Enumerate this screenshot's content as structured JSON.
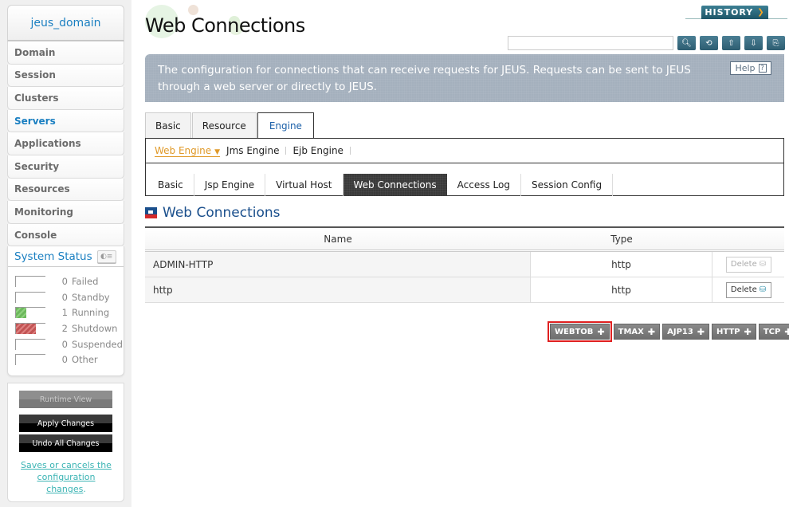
{
  "sidebar": {
    "domain": "jeus_domain",
    "items": [
      {
        "label": "Domain",
        "active": false
      },
      {
        "label": "Session",
        "active": false
      },
      {
        "label": "Clusters",
        "active": false
      },
      {
        "label": "Servers",
        "active": true
      },
      {
        "label": "Applications",
        "active": false
      },
      {
        "label": "Security",
        "active": false
      },
      {
        "label": "Resources",
        "active": false
      },
      {
        "label": "Monitoring",
        "active": false
      },
      {
        "label": "Console",
        "active": false
      }
    ],
    "system_status": {
      "title": "System Status",
      "rows": [
        {
          "count": "0",
          "label": "Failed",
          "fraction": 0
        },
        {
          "count": "0",
          "label": "Standby",
          "fraction": 0
        },
        {
          "count": "1",
          "label": "Running",
          "fraction": 0.33,
          "color": "#6cb85c"
        },
        {
          "count": "2",
          "label": "Shutdown",
          "fraction": 0.67,
          "color": "#c25454"
        },
        {
          "count": "0",
          "label": "Suspended",
          "fraction": 0
        },
        {
          "count": "0",
          "label": "Other",
          "fraction": 0
        }
      ]
    },
    "actions": {
      "runtime_view": "Runtime View",
      "apply": "Apply Changes",
      "undo": "Undo All Changes",
      "note_link": "Saves or cancels the configuration changes",
      "note_tail": "."
    }
  },
  "header": {
    "title": "Web Connections",
    "history": "HISTORY",
    "search_value": "",
    "tools": [
      "search-icon",
      "refresh-icon",
      "xml-upload-icon",
      "xml-download-icon",
      "export-icon"
    ]
  },
  "info": {
    "text": "The configuration for connections that can receive requests for JEUS. Requests can be sent to JEUS through a web server or directly to JEUS.",
    "help": "Help"
  },
  "tabs": {
    "top": [
      {
        "label": "Basic",
        "active": false
      },
      {
        "label": "Resource",
        "active": false
      },
      {
        "label": "Engine",
        "active": true
      }
    ],
    "engines": [
      {
        "label": "Web Engine",
        "active": true
      },
      {
        "label": "Jms Engine",
        "active": false
      },
      {
        "label": "Ejb Engine",
        "active": false
      }
    ],
    "config": [
      {
        "label": "Basic",
        "active": false
      },
      {
        "label": "Jsp Engine",
        "active": false
      },
      {
        "label": "Virtual Host",
        "active": false
      },
      {
        "label": "Web Connections",
        "active": true
      },
      {
        "label": "Access Log",
        "active": false
      },
      {
        "label": "Session Config",
        "active": false
      }
    ]
  },
  "section": {
    "title": "Web Connections",
    "columns": {
      "name": "Name",
      "type": "Type"
    },
    "rows": [
      {
        "name": "ADMIN-HTTP",
        "type": "http",
        "delete": "Delete",
        "delete_enabled": false
      },
      {
        "name": "http",
        "type": "http",
        "delete": "Delete",
        "delete_enabled": true
      }
    ],
    "add_buttons": [
      {
        "label": "WEBTOB",
        "highlighted": true
      },
      {
        "label": "TMAX",
        "highlighted": false
      },
      {
        "label": "AJP13",
        "highlighted": false
      },
      {
        "label": "HTTP",
        "highlighted": false
      },
      {
        "label": "TCP",
        "highlighted": false
      }
    ]
  }
}
